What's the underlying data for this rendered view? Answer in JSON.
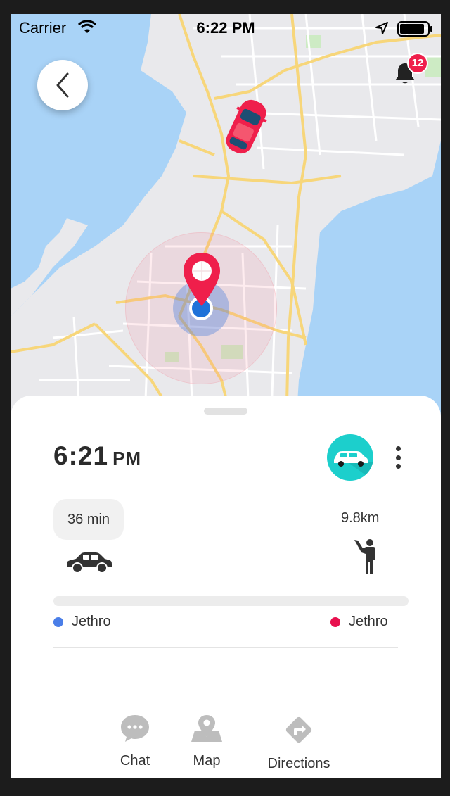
{
  "status_bar": {
    "carrier": "Carrier",
    "time": "6:22 PM"
  },
  "notifications": {
    "count": "12"
  },
  "trip": {
    "eta_time": "6:21",
    "eta_ampm": "PM",
    "duration": "36 min",
    "distance": "9.8km",
    "from_name": "Jethro",
    "to_name": "Jethro",
    "progress": 0.0
  },
  "actions": {
    "chat": "Chat",
    "map": "Map",
    "directions": "Directions"
  },
  "colors": {
    "accent": "#ef1f4b",
    "origin_dot": "#4a7ee8",
    "destination_dot": "#e8104e",
    "vehicle_avatar": "#1ccfcc",
    "water": "#a9d3f7",
    "land": "#e9e9ec",
    "road": "#f7d67a"
  },
  "icons": {
    "back": "chevron-left-icon",
    "notification": "bell-icon",
    "vehicle": "car-icon",
    "rider": "person-waving-icon",
    "chat": "chat-bubble-icon",
    "map": "map-pin-icon",
    "directions": "directions-sign-icon"
  }
}
